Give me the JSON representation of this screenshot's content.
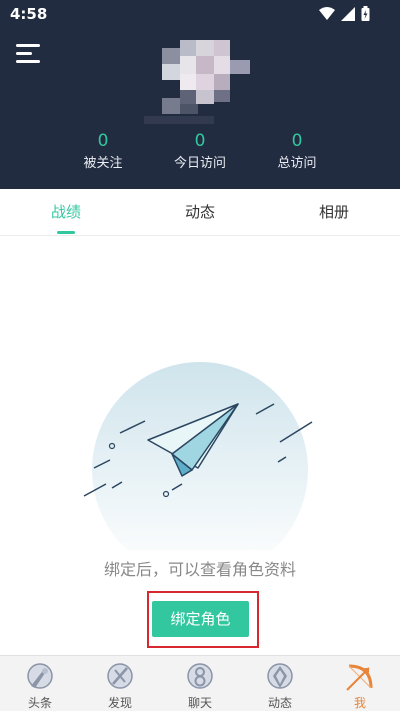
{
  "status_bar": {
    "time": "4:58"
  },
  "profile": {
    "stats": [
      {
        "value": "0",
        "label": "被关注"
      },
      {
        "value": "0",
        "label": "今日访问"
      },
      {
        "value": "0",
        "label": "总访问"
      }
    ]
  },
  "tabs": [
    {
      "label": "战绩",
      "active": true
    },
    {
      "label": "动态",
      "active": false
    },
    {
      "label": "相册",
      "active": false
    }
  ],
  "empty_state": {
    "message": "绑定后，可以查看角色资料",
    "button_label": "绑定角色"
  },
  "bottom_nav": [
    {
      "label": "头条",
      "icon": "headline-icon"
    },
    {
      "label": "发现",
      "icon": "discover-icon"
    },
    {
      "label": "聊天",
      "icon": "chat-icon"
    },
    {
      "label": "动态",
      "icon": "feed-icon"
    },
    {
      "label": "我",
      "icon": "me-bow-icon",
      "active": true
    }
  ],
  "colors": {
    "header_bg": "#222c40",
    "accent": "#33c7a0",
    "highlight_frame": "#d8282f",
    "active_nav": "#e8853a"
  }
}
